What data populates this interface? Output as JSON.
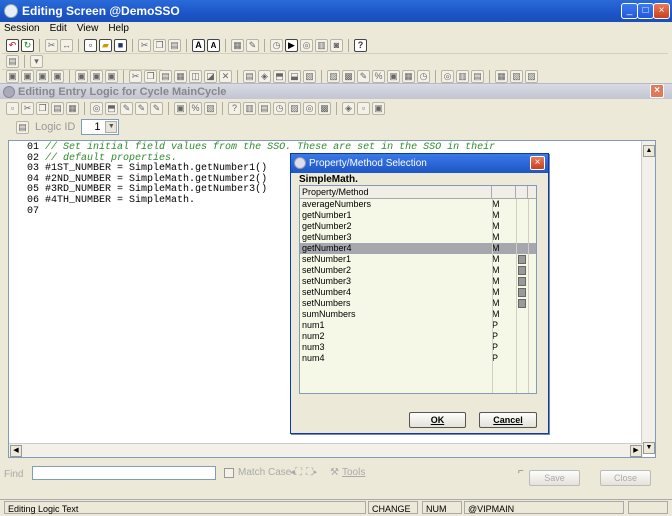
{
  "window": {
    "title": "Editing Screen @DemoSSO"
  },
  "menu": [
    "Session",
    "Edit",
    "View",
    "Help"
  ],
  "sub_window": {
    "title": "Editing Entry Logic for Cycle MainCycle"
  },
  "logic_id": {
    "label": "Logic ID",
    "value": "1"
  },
  "editor": {
    "lines": [
      {
        "num": "01",
        "text": "// Set initial field values from the SSO. These are set in the SSO in their",
        "comment": true
      },
      {
        "num": "02",
        "text": "// default properties.",
        "comment": true
      },
      {
        "num": "03",
        "text": "#1ST_NUMBER = SimpleMath.getNumber1()",
        "comment": false
      },
      {
        "num": "04",
        "text": "#2ND_NUMBER = SimpleMath.getNumber2()",
        "comment": false
      },
      {
        "num": "05",
        "text": "#3RD_NUMBER = SimpleMath.getNumber3()",
        "comment": false
      },
      {
        "num": "06",
        "text": "#4TH_NUMBER = SimpleMath.",
        "comment": false
      },
      {
        "num": "07",
        "text": "",
        "comment": false
      }
    ]
  },
  "find": {
    "label": "Find",
    "match_case": "Match Case",
    "tools": "Tools"
  },
  "buttons": {
    "save": "Save",
    "close": "Close"
  },
  "status": {
    "text": "Editing Logic Text",
    "change": "CHANGE",
    "num": "NUM",
    "server": "@VIPMAIN"
  },
  "dialog": {
    "title": "Property/Method Selection",
    "class_name": "SimpleMath.",
    "header": "Property/Method",
    "items": [
      {
        "name": "averageNumbers",
        "type": "M",
        "selected": false,
        "marker": false
      },
      {
        "name": "getNumber1",
        "type": "M",
        "selected": false,
        "marker": false
      },
      {
        "name": "getNumber2",
        "type": "M",
        "selected": false,
        "marker": false
      },
      {
        "name": "getNumber3",
        "type": "M",
        "selected": false,
        "marker": false
      },
      {
        "name": "getNumber4",
        "type": "M",
        "selected": true,
        "marker": false
      },
      {
        "name": "setNumber1",
        "type": "M",
        "selected": false,
        "marker": true
      },
      {
        "name": "setNumber2",
        "type": "M",
        "selected": false,
        "marker": true
      },
      {
        "name": "setNumber3",
        "type": "M",
        "selected": false,
        "marker": true
      },
      {
        "name": "setNumber4",
        "type": "M",
        "selected": false,
        "marker": true
      },
      {
        "name": "setNumbers",
        "type": "M",
        "selected": false,
        "marker": true
      },
      {
        "name": "sumNumbers",
        "type": "M",
        "selected": false,
        "marker": false
      },
      {
        "name": "num1",
        "type": "P",
        "selected": false,
        "marker": false
      },
      {
        "name": "num2",
        "type": "P",
        "selected": false,
        "marker": false
      },
      {
        "name": "num3",
        "type": "P",
        "selected": false,
        "marker": false
      },
      {
        "name": "num4",
        "type": "P",
        "selected": false,
        "marker": false
      }
    ],
    "ok": "OK",
    "cancel": "Cancel"
  }
}
